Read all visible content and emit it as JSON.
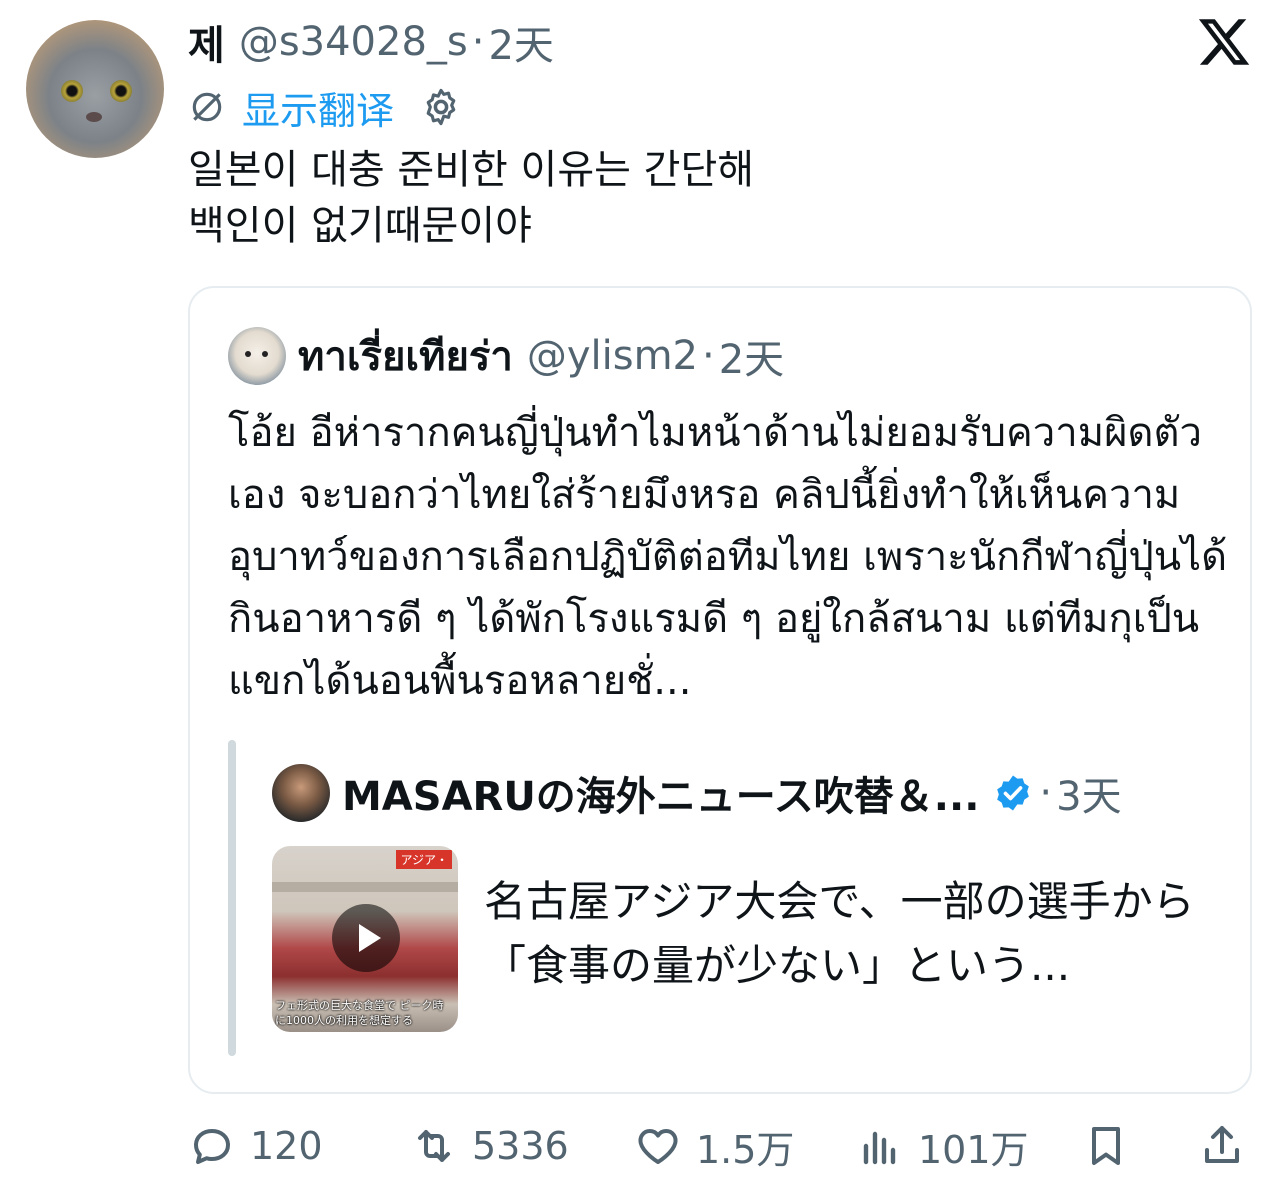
{
  "tweet": {
    "display_name": "제",
    "handle": "@s34028_s",
    "separator": "·",
    "time": "2天",
    "translate_label": "显示翻译",
    "text": "일본이 대충 준비한 이유는 간단해\n백인이 없기때문이야"
  },
  "quoted": {
    "display_name": "ทาเรี่ยเทียร่า",
    "handle": "@ylism2",
    "separator": "·",
    "time": "2天",
    "text": "โอ้ย อีห่ารากคนญี่ปุ่นทำไมหน้าด้านไม่ยอมรับความผิดตัวเอง จะบอกว่าไทยใส่ร้ายมึงหรอ คลิปนี้ยิ่งทำให้เห็นความอุบาทว์ของการเลือกปฏิบัติต่อทีมไทย เพราะนักกีฬาญี่ปุ่นได้กินอาหารดี ๆ ได้พักโรงแรมดี ๆ อยู่ใกล้สนาม แต่ทีมกุเป็นแขกได้นอนพื้นรอหลายชั่..."
  },
  "nested": {
    "display_name": "MASARUの海外ニュース吹替＆...",
    "separator": "·",
    "time": "3天",
    "text": "名古屋アジア大会で、一部の選手から「食事の量が少ない」という...",
    "thumb_tag": "アジア・",
    "thumb_caption": "フェ形式の巨大な食堂で ピーク時\nに1000人の利用を想定する"
  },
  "actions": {
    "replies": "120",
    "reposts": "5336",
    "likes": "1.5万",
    "views": "101万"
  },
  "colors": {
    "accent": "#1d9bf0",
    "muted": "#536471",
    "text": "#0f1419",
    "border": "#e6ecf0"
  },
  "icons": [
    "x-logo-icon",
    "translate-globe-icon",
    "gear-icon",
    "verified-badge-icon",
    "play-icon",
    "reply-icon",
    "repost-icon",
    "like-icon",
    "views-icon",
    "bookmark-icon",
    "share-icon"
  ]
}
